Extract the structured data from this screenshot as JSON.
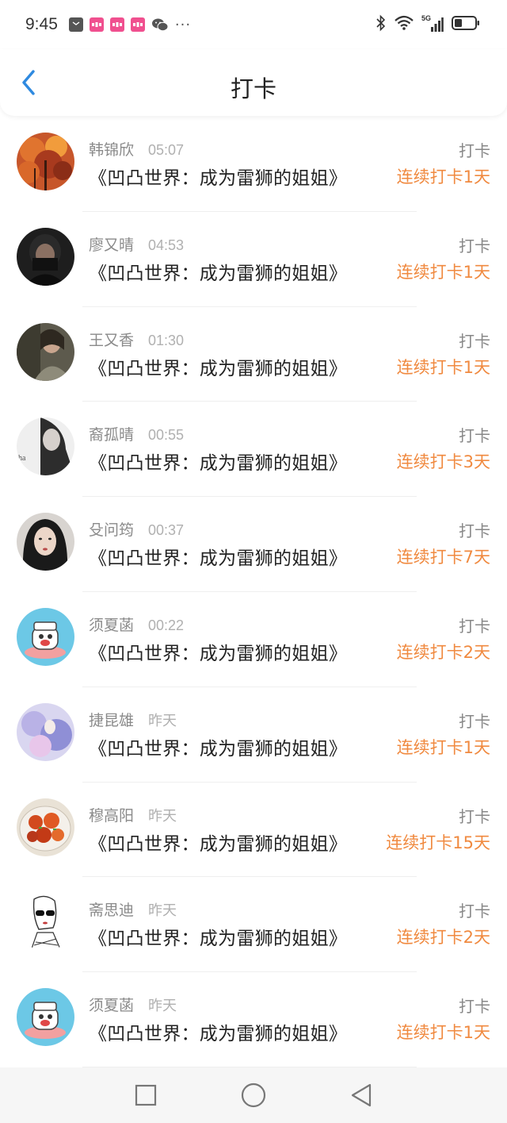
{
  "status_bar": {
    "time": "9:45",
    "notification_icons": [
      "notification-icon",
      "app-icon",
      "app-icon",
      "app-icon",
      "wechat-icon"
    ],
    "more": "···",
    "network": "5G"
  },
  "header": {
    "title": "打卡"
  },
  "colors": {
    "accent_blue": "#2f8ae0",
    "streak_orange": "#f08a40",
    "name_gray": "#8a8a8a",
    "time_gray": "#b0b0b0"
  },
  "checkins": [
    {
      "name": "韩锦欣",
      "time": "05:07",
      "book": "《凹凸世界：成为雷狮的姐姐》",
      "tag": "打卡",
      "streak": "连续打卡1天"
    },
    {
      "name": "廖又晴",
      "time": "04:53",
      "book": "《凹凸世界：成为雷狮的姐姐》",
      "tag": "打卡",
      "streak": "连续打卡1天"
    },
    {
      "name": "王又香",
      "time": "01:30",
      "book": "《凹凸世界：成为雷狮的姐姐》",
      "tag": "打卡",
      "streak": "连续打卡1天"
    },
    {
      "name": "裔孤晴",
      "time": "00:55",
      "book": "《凹凸世界：成为雷狮的姐姐》",
      "tag": "打卡",
      "streak": "连续打卡3天"
    },
    {
      "name": "殳问筠",
      "time": "00:37",
      "book": "《凹凸世界：成为雷狮的姐姐》",
      "tag": "打卡",
      "streak": "连续打卡7天"
    },
    {
      "name": "须夏菡",
      "time": "00:22",
      "book": "《凹凸世界：成为雷狮的姐姐》",
      "tag": "打卡",
      "streak": "连续打卡2天"
    },
    {
      "name": "捷昆雄",
      "time": "昨天",
      "book": "《凹凸世界：成为雷狮的姐姐》",
      "tag": "打卡",
      "streak": "连续打卡1天"
    },
    {
      "name": "穆高阳",
      "time": "昨天",
      "book": "《凹凸世界：成为雷狮的姐姐》",
      "tag": "打卡",
      "streak": "连续打卡15天"
    },
    {
      "name": "斋思迪",
      "time": "昨天",
      "book": "《凹凸世界：成为雷狮的姐姐》",
      "tag": "打卡",
      "streak": "连续打卡2天"
    },
    {
      "name": "须夏菡",
      "time": "昨天",
      "book": "《凹凸世界：成为雷狮的姐姐》",
      "tag": "打卡",
      "streak": "连续打卡1天"
    }
  ]
}
